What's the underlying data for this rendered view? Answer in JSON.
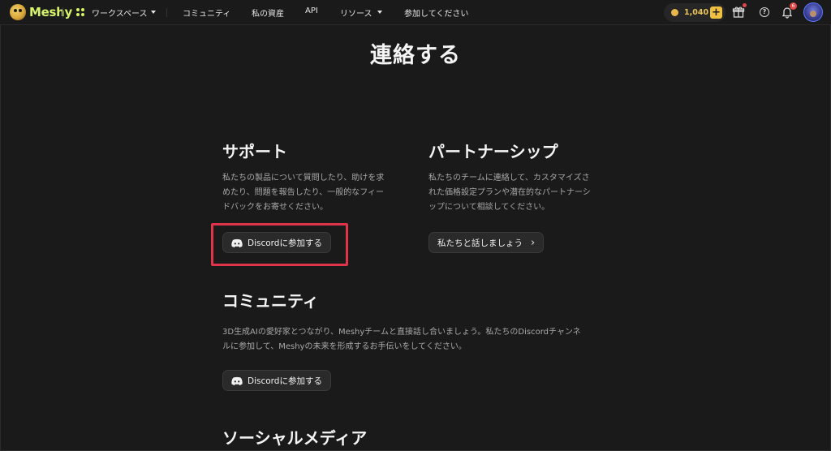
{
  "nav": {
    "brand": "Meshy",
    "workspace": "ワークスペース",
    "community": "コミュニティ",
    "assets": "私の資産",
    "api": "API",
    "resources": "リソース",
    "participate": "参加してください",
    "credits": "1,040",
    "plus": "+",
    "help": "?",
    "notification_count": "6",
    "colors": {
      "brand": "#d6f36a",
      "coin": "#e9c45b",
      "alert": "#e04848"
    }
  },
  "page": {
    "title": "連絡する"
  },
  "support": {
    "heading": "サポート",
    "line1": "私たちの製品について質問したり、助けを求",
    "line2": "めたり、問題を報告したり、一般的なフィー",
    "line3": "ドバックをお寄せください。",
    "button": "Discordに参加する"
  },
  "partnership": {
    "heading": "パートナーシップ",
    "line1": "私たちのチームに連絡して、カスタマイズさ",
    "line2": "れた価格設定プランや潜在的なパートナーシ",
    "line3": "ップについて相談してください。",
    "button": "私たちと話しましょう"
  },
  "community": {
    "heading": "コミュニティ",
    "line1": "3D生成AIの愛好家とつながり、Meshyチームと直接話し合いましょう。私たちのDiscordチャンネ",
    "line2": "ルに参加して、Meshyの未来を形成するお手伝いをしてください。",
    "button": "Discordに参加する"
  },
  "social": {
    "heading": "ソーシャルメディア"
  },
  "annotation": {
    "highlight_color": "#e0344b"
  }
}
